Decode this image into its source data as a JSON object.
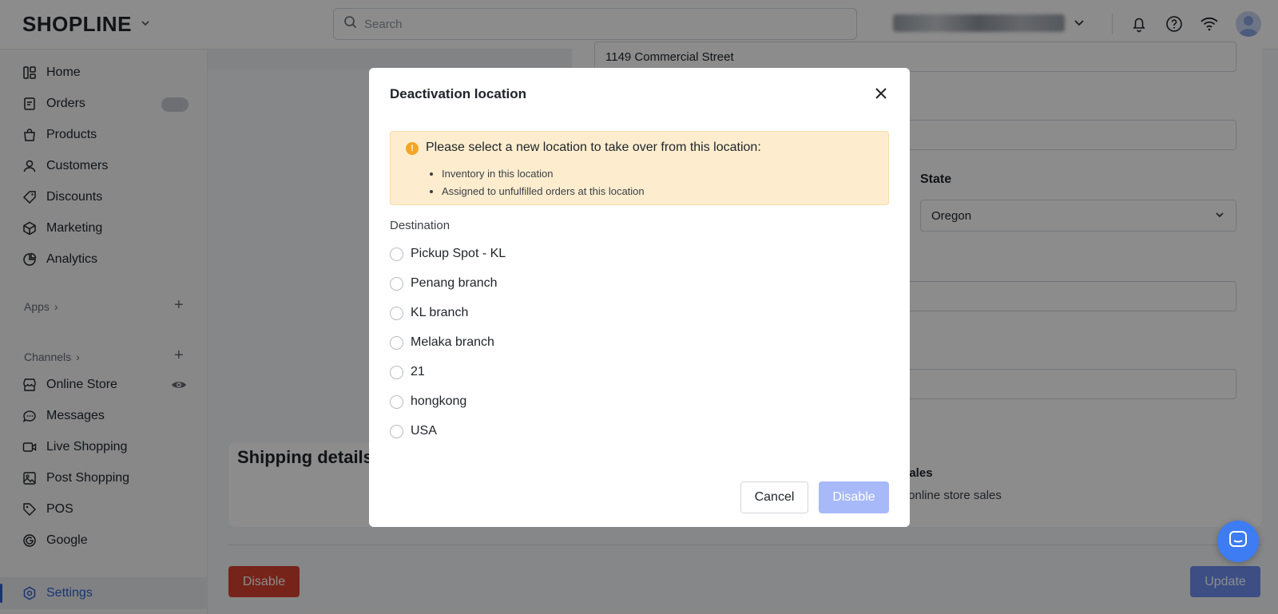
{
  "header": {
    "logo": "SHOPLINE",
    "search_placeholder": "Search",
    "icons": [
      "bell-icon",
      "help-icon",
      "wifi-icon",
      "avatar"
    ]
  },
  "sidebar": {
    "items": [
      {
        "label": "Home",
        "icon": "home-icon"
      },
      {
        "label": "Orders",
        "icon": "orders-icon"
      },
      {
        "label": "Products",
        "icon": "bag-icon"
      },
      {
        "label": "Customers",
        "icon": "user-icon"
      },
      {
        "label": "Discounts",
        "icon": "tag-icon"
      },
      {
        "label": "Marketing",
        "icon": "cube-icon"
      },
      {
        "label": "Analytics",
        "icon": "chart-icon"
      }
    ],
    "apps_label": "Apps",
    "channels_label": "Channels",
    "channels": [
      {
        "label": "Online Store",
        "icon": "store-icon"
      },
      {
        "label": "Messages",
        "icon": "message-icon"
      },
      {
        "label": "Live Shopping",
        "icon": "video-icon"
      },
      {
        "label": "Post Shopping",
        "icon": "image-icon"
      },
      {
        "label": "POS",
        "icon": "pos-icon"
      },
      {
        "label": "Google",
        "icon": "google-icon"
      }
    ],
    "settings_label": "Settings"
  },
  "main": {
    "address_value": "1149 Commercial Street",
    "state_label": "State",
    "state_value": "Oregon",
    "shipping_title": "Shipping details",
    "sales_heading_fragment": "sales",
    "sales_sub_fragment": "r online store sales",
    "disable_button": "Disable",
    "update_button": "Update"
  },
  "modal": {
    "title": "Deactivation location",
    "alert_title": "Please select a new location to take over from this location:",
    "alert_items": [
      "Inventory in this location",
      "Assigned to unfulfilled orders at this location"
    ],
    "destination_label": "Destination",
    "options": [
      "Pickup Spot - KL",
      "Penang branch",
      "KL branch",
      "Melaka branch",
      "21",
      "hongkong",
      "USA"
    ],
    "cancel_label": "Cancel",
    "disable_label": "Disable"
  },
  "colors": {
    "accent": "#2d5fd0",
    "danger": "#d8412e",
    "disabled_primary": "#a7b9f8",
    "warning_bg": "#fdedce",
    "warning_icon": "#f5a524"
  }
}
